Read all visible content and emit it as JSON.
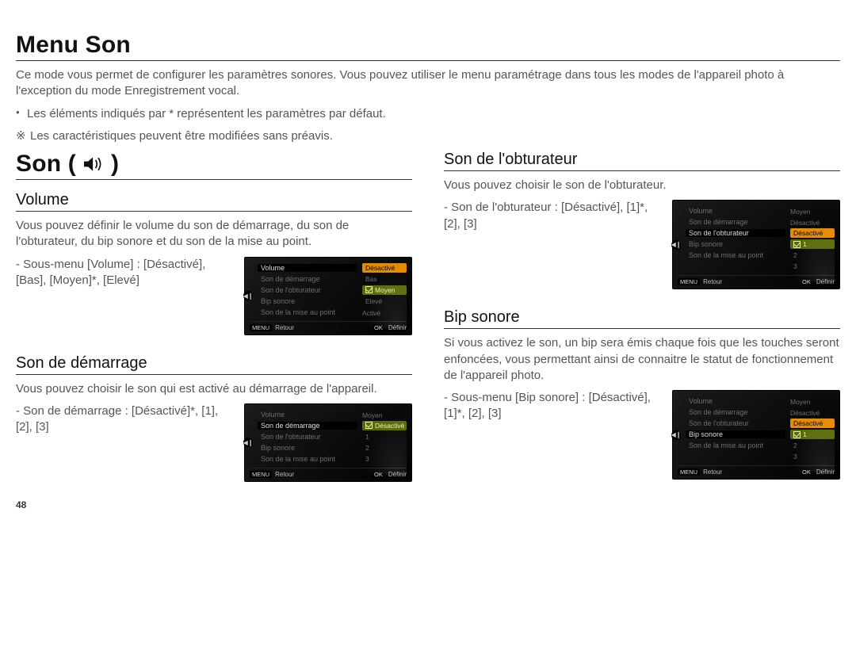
{
  "page_number": "48",
  "title": "Menu Son",
  "intro": {
    "p1": "Ce mode vous permet de configurer les paramètres sonores. Vous pouvez utiliser le menu paramétrage dans tous les modes de l'appareil photo à l'exception du mode Enregistrement vocal.",
    "bullet": "Les éléments indiqués par * représentent les paramètres par défaut.",
    "note": "Les caractéristiques peuvent être modifiées sans préavis."
  },
  "son": {
    "heading": "Son (",
    "heading_close": ")"
  },
  "sections": {
    "volume": {
      "title": "Volume",
      "desc": "Vous pouvez définir le volume du son de démarrage, du son de l'obturateur, du bip sonore et du son de la mise au point.",
      "spec_label": "- Sous-menu [Volume] :",
      "spec_values": "[Désactivé], [Bas], [Moyen]*, [Elevé]"
    },
    "demarrage": {
      "title": "Son de démarrage",
      "desc": "Vous pouvez choisir le son qui est activé au démarrage de l'appareil.",
      "spec_label": "- Son de démarrage :",
      "spec_values": "[Désactivé]*, [1], [2], [3]"
    },
    "obturateur": {
      "title": "Son de l'obturateur",
      "desc": "Vous pouvez choisir le son de l'obturateur.",
      "spec_label": "- Son de l'obturateur :",
      "spec_values": "[Désactivé], [1]*, [2], [3]"
    },
    "bip": {
      "title": "Bip sonore",
      "desc": "Si vous activez le son, un bip sera émis chaque fois que les touches seront enfoncées, vous permettant ainsi de connaitre le statut de fonctionnement de l'appareil photo.",
      "spec_label": "- Sous-menu [Bip sonore] :",
      "spec_values": "[Désactivé], [1]*, [2], [3]"
    }
  },
  "lcd_common": {
    "items": {
      "volume": "Volume",
      "demarrage": "Son de démarrage",
      "obturateur": "Son de l'obturateur",
      "bip": "Bip sonore",
      "maf": "Son de la mise au point"
    },
    "vals": {
      "moyen": "Moyen",
      "desactive": "Désactivé",
      "bas": "Bas",
      "eleve": "Elevé",
      "active": "Activé",
      "one": "1",
      "two": "2",
      "three": "3"
    },
    "footer": {
      "menu_tag": "MENU",
      "back": "Retour",
      "ok_tag": "OK",
      "set": "Définir"
    },
    "side_icon": "◀❙"
  }
}
